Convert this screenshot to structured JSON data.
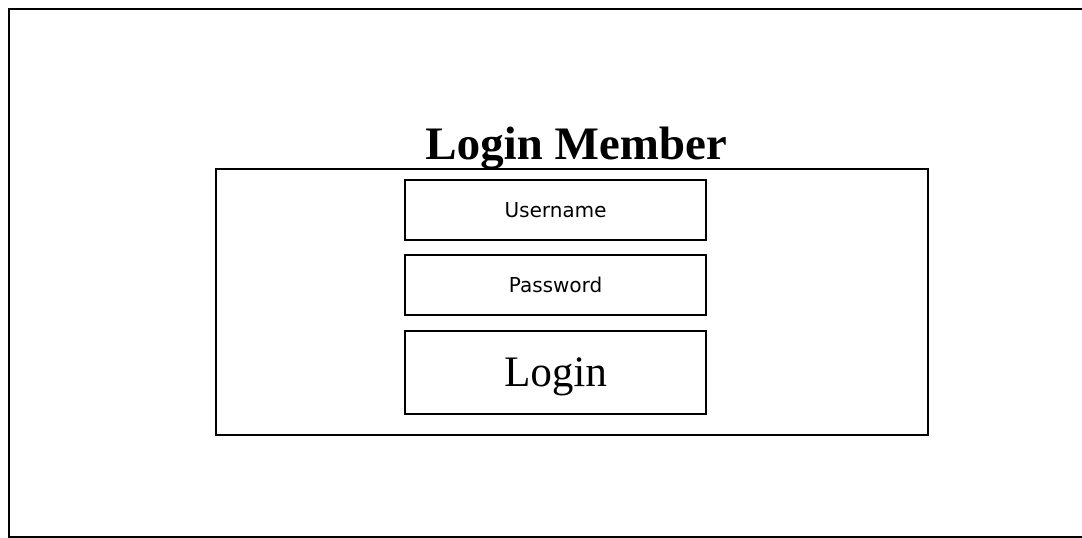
{
  "page": {
    "title": "Login Member"
  },
  "form": {
    "username_label": "Username",
    "password_label": "Password",
    "login_label": "Login"
  }
}
